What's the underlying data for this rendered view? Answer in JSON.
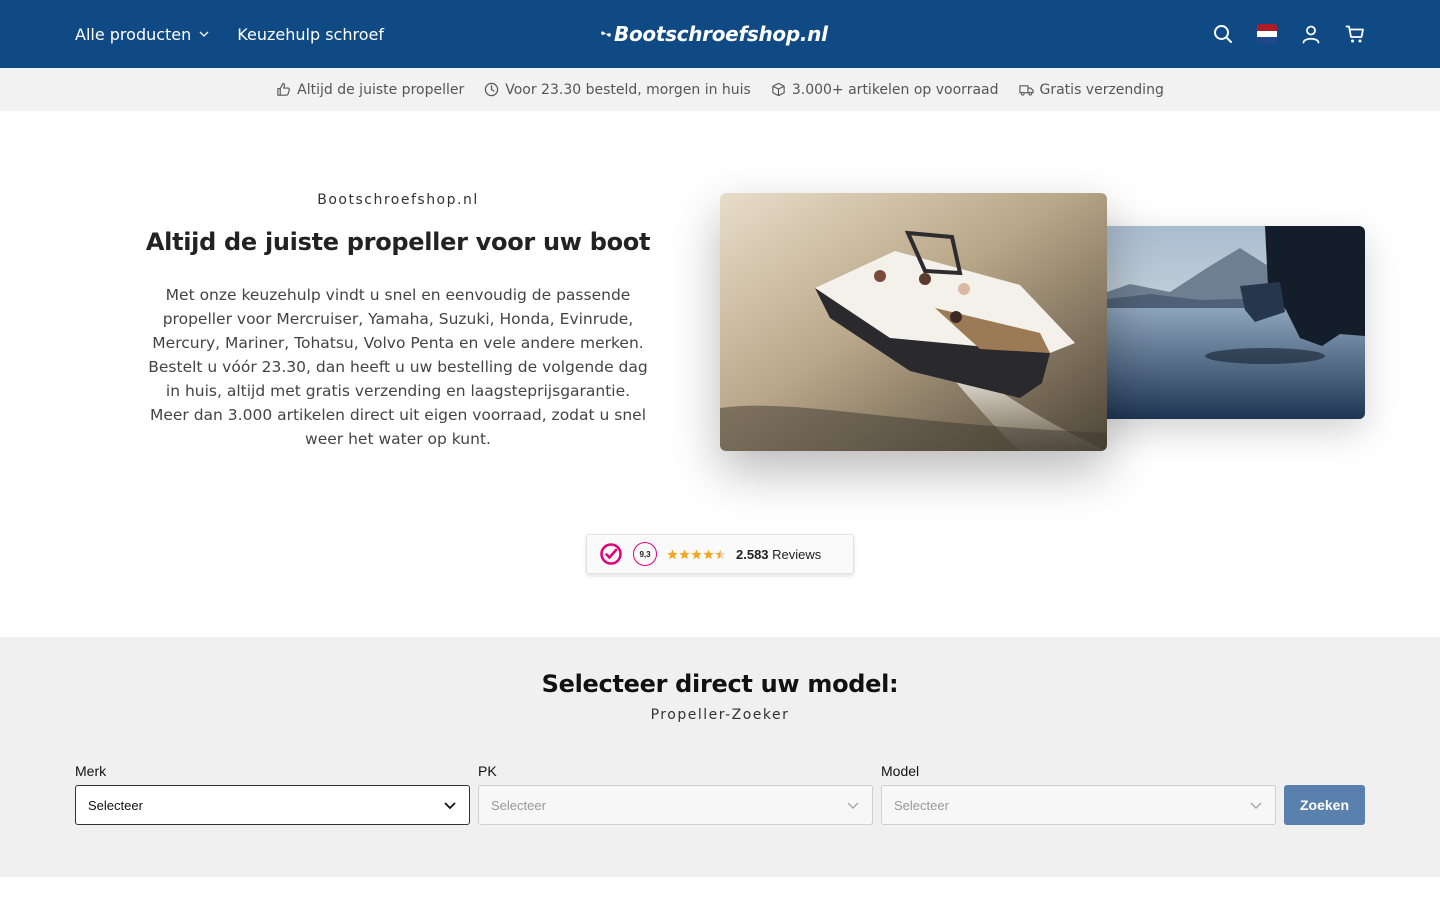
{
  "header": {
    "nav": [
      {
        "label": "Alle producten",
        "has_dropdown": true
      },
      {
        "label": "Keuzehulp schroef",
        "has_dropdown": false
      }
    ],
    "logo_text": "Bootschroefshop.nl",
    "icons": [
      "search-icon",
      "flag-nl-icon",
      "account-icon",
      "cart-icon"
    ],
    "background_color": "#0f4a85"
  },
  "usp_bar": [
    {
      "icon": "thumbs-up-icon",
      "text": "Altijd de juiste propeller"
    },
    {
      "icon": "clock-icon",
      "text": "Voor 23.30 besteld, morgen in huis"
    },
    {
      "icon": "box-icon",
      "text": "3.000+ artikelen op voorraad"
    },
    {
      "icon": "truck-icon",
      "text": "Gratis verzending"
    }
  ],
  "hero": {
    "kicker": "Bootschroefshop.nl",
    "title": "Altijd de juiste propeller voor uw boot",
    "body": "Met onze keuzehulp vindt u snel en eenvoudig de passende propeller voor Mercruiser, Yamaha, Suzuki, Honda, Evinrude, Mercury, Mariner, Tohatsu, Volvo Penta en vele andere merken. Bestelt u vóór 23.30, dan heeft u uw bestelling de volgende dag in huis, altijd met gratis verzending en laagsteprijsgarantie. Meer dan 3.000 artikelen direct uit eigen voorraad, zodat u snel weer het water op kunt."
  },
  "reviews": {
    "score": "9,3",
    "rating_stars": 4.5,
    "count": "2.583",
    "label": "Reviews",
    "accent_color": "#e3007b"
  },
  "finder": {
    "title": "Selecteer direct uw model:",
    "subtitle": "Propeller-Zoeker",
    "fields": [
      {
        "label": "Merk",
        "value": "Selecteer",
        "enabled": true
      },
      {
        "label": "PK",
        "value": "Selecteer",
        "enabled": false
      },
      {
        "label": "Model",
        "value": "Selecteer",
        "enabled": false
      }
    ],
    "button_label": "Zoeken",
    "button_color": "#5a81ad"
  }
}
